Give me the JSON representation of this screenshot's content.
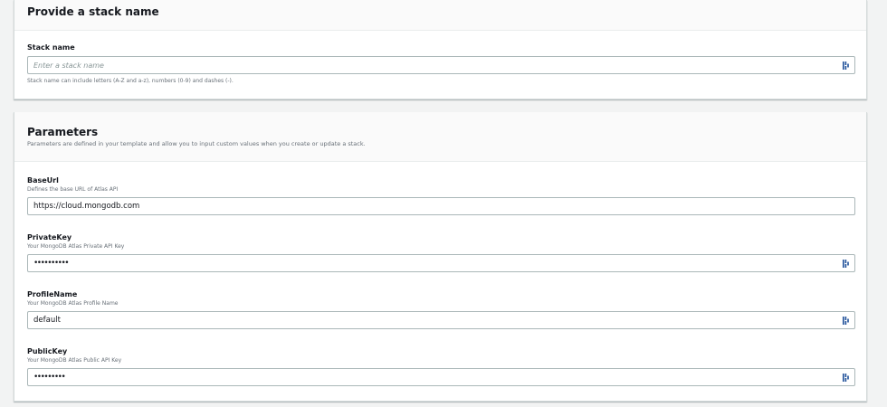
{
  "stack_panel": {
    "title": "Provide a stack name",
    "field_label": "Stack name",
    "placeholder": "Enter a stack name",
    "hint": "Stack name can include letters (A-Z and a-z), numbers (0-9) and dashes (-)."
  },
  "params_panel": {
    "title": "Parameters",
    "description": "Parameters are defined in your template and allow you to input custom values when you create or update a stack.",
    "fields": [
      {
        "label": "BaseUrl",
        "description": "Defines the base URL of Atlas API",
        "value": "https://cloud.mongodb.com"
      },
      {
        "label": "PrivateKey",
        "description": "Your MongoDB Atlas Private API Key",
        "value": "••••••••••"
      },
      {
        "label": "ProfileName",
        "description": "Your MongoDB Atlas Profile Name",
        "value": "default"
      },
      {
        "label": "PublicKey",
        "description": "Your MongoDB Atlas Public API Key",
        "value": "•••••••••"
      }
    ]
  },
  "icons": {
    "field_icon": "password-manager-key-icon"
  }
}
